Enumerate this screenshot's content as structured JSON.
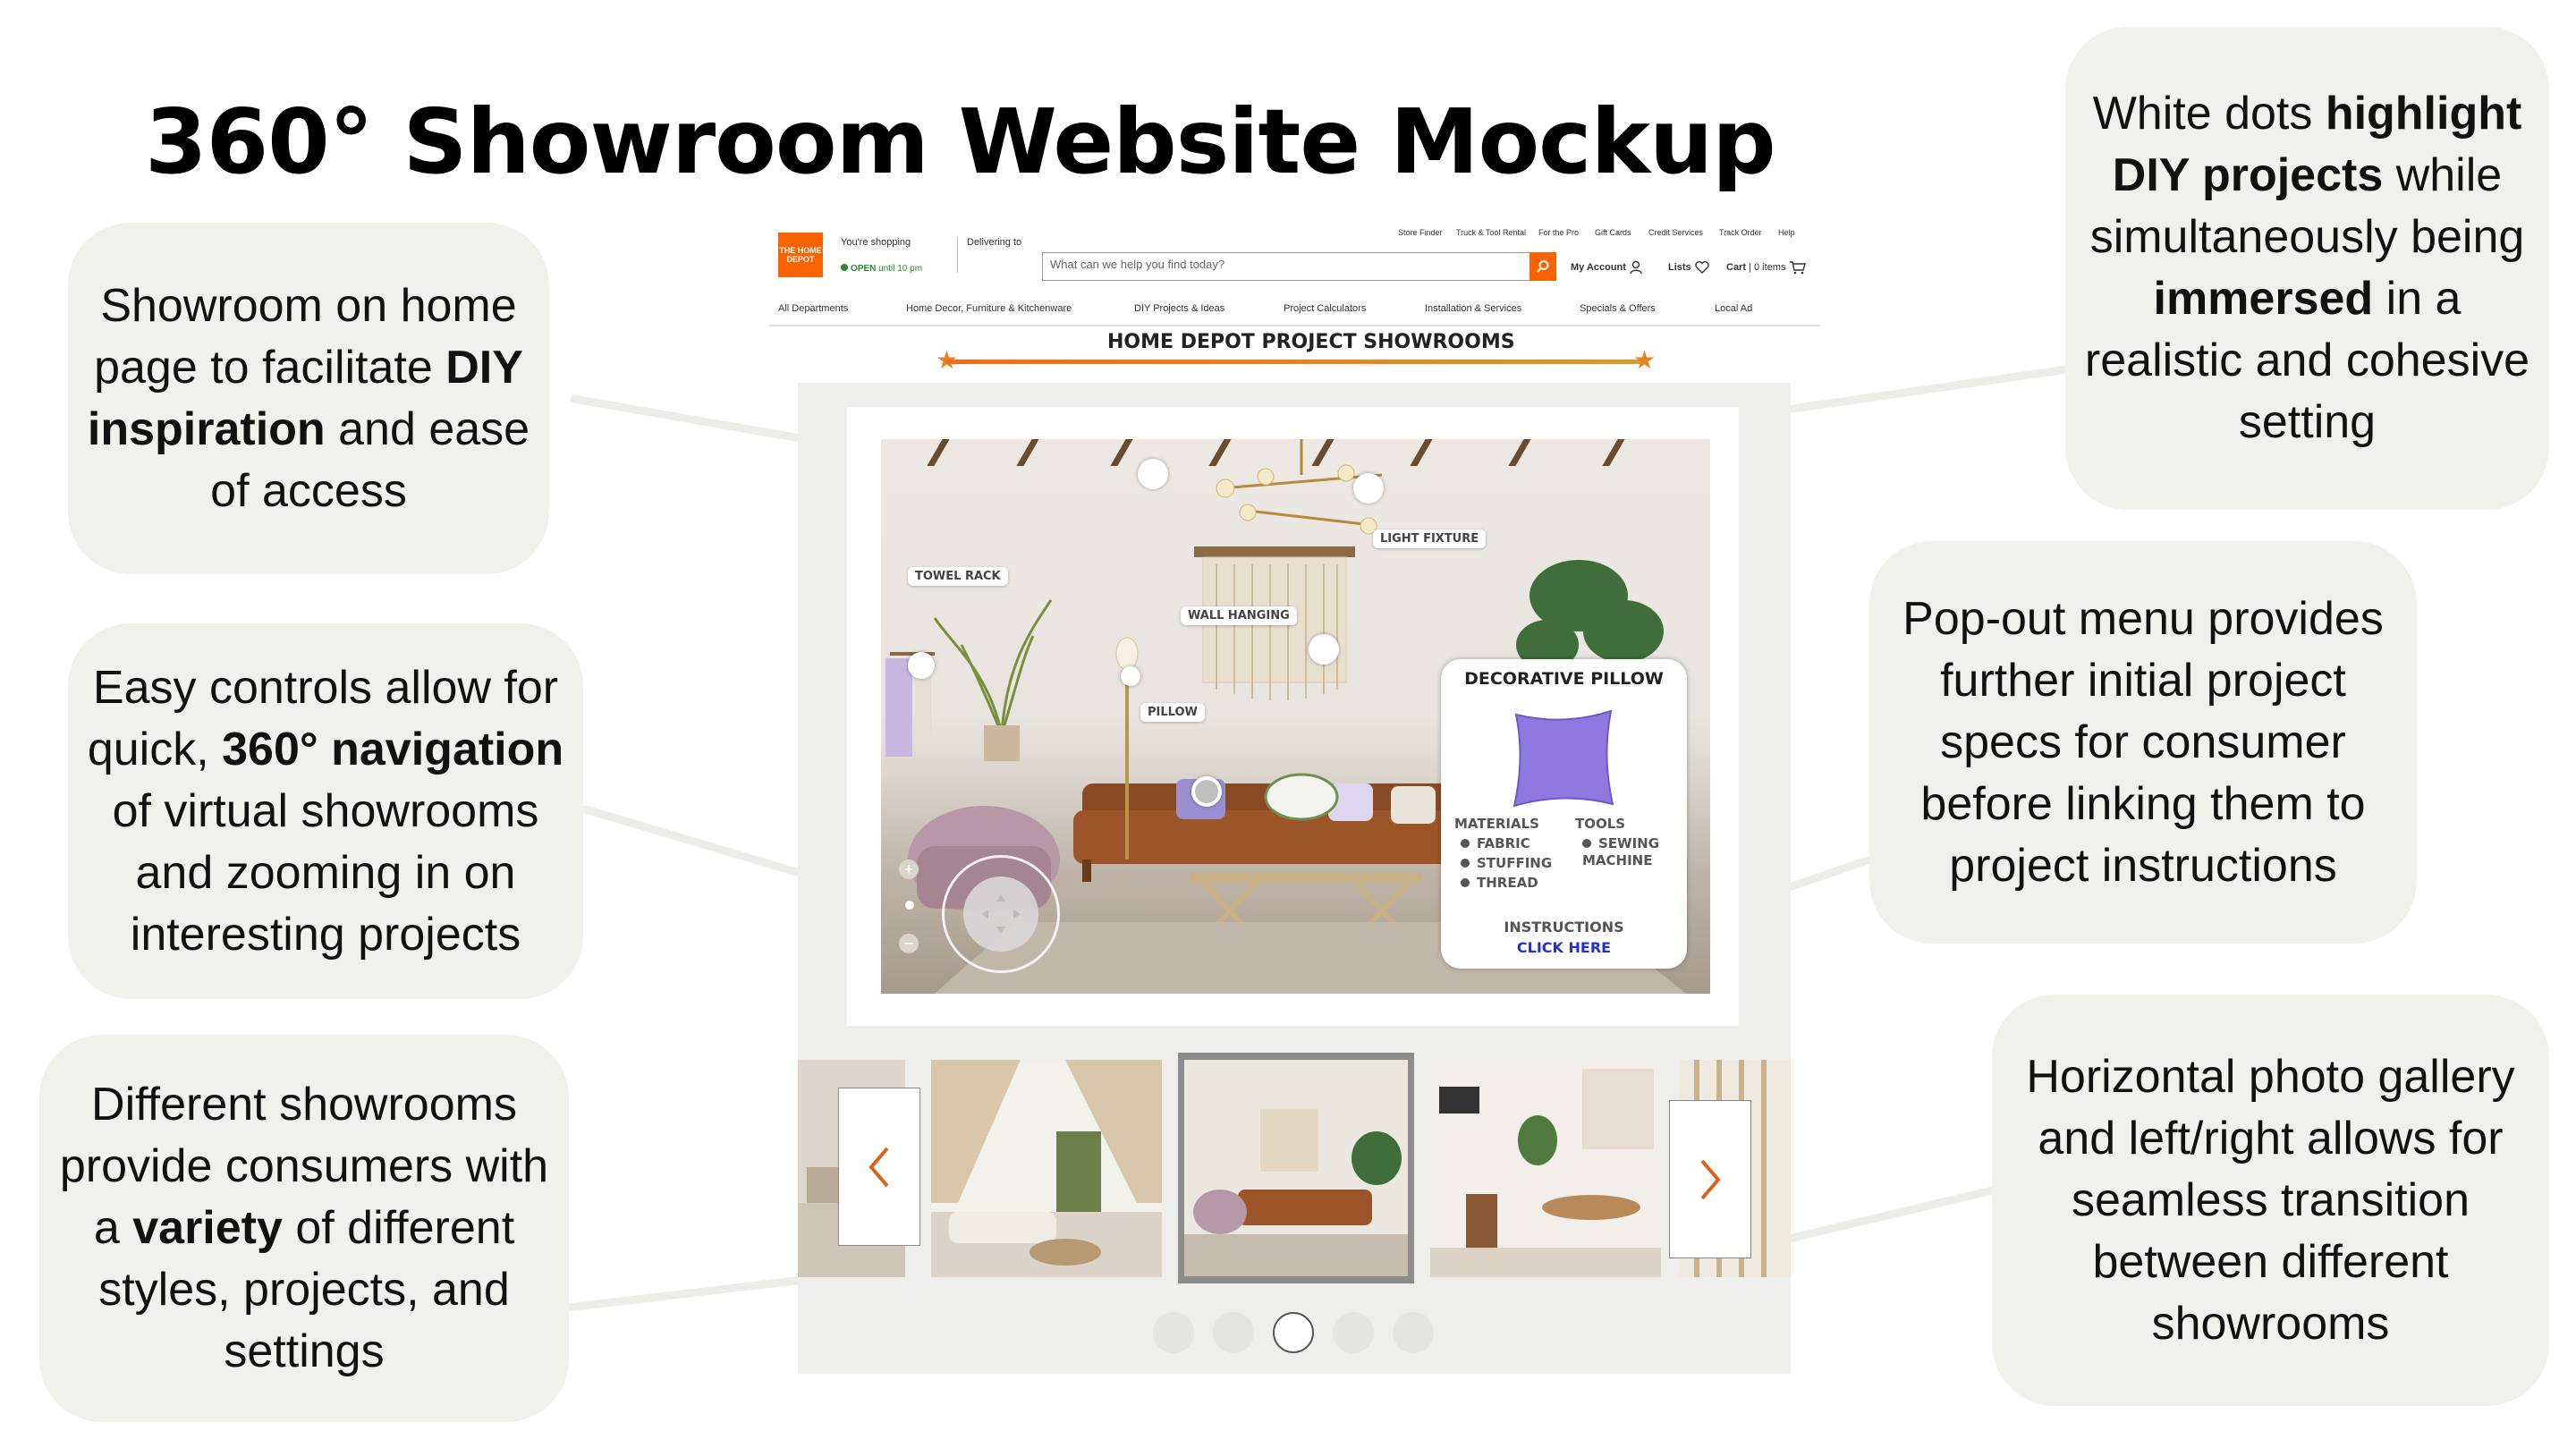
{
  "title": "360° Showroom Website Mockup",
  "callouts": {
    "left_1": {
      "pre": "Showroom on home page to facilitate ",
      "bold": "DIY inspiration",
      "post": " and ease of access"
    },
    "left_2": {
      "pre": "Easy controls allow for quick, ",
      "bold": "360° navigation",
      "post": " of virtual showrooms and zooming in on interesting projects"
    },
    "left_3": {
      "pre": "Different showrooms provide consumers with a ",
      "bold": "variety",
      "post": " of different styles, projects, and settings"
    },
    "right_1": {
      "p1": "White dots ",
      "b1": "highlight DIY projects",
      "p2": " while simultaneously being ",
      "b2": "immersed",
      "p3": " in a realistic and cohesive setting"
    },
    "right_2": "Pop-out menu provides further initial project specs for consumer before linking them to project instructions",
    "right_3": "Horizontal photo gallery and left/right allows for seamless transition between different showrooms"
  },
  "site": {
    "logo": "THE HOME DEPOT",
    "youre_shopping": "You're shopping",
    "open_status": "OPEN",
    "open_hours": "until 10 pm",
    "delivering_to": "Delivering to",
    "utility_links": [
      "Store Finder",
      "Truck & Tool Rental",
      "For the Pro",
      "Gift Cards",
      "Credit Services",
      "Track Order",
      "Help"
    ],
    "search_placeholder": "What can we help you find today?",
    "my_account": "My Account",
    "lists": "Lists",
    "cart": "Cart",
    "cart_items": "0 items",
    "nav": [
      "All Departments",
      "Home Decor, Furniture & Kitchenware",
      "DIY Projects & Ideas",
      "Project Calculators",
      "Installation & Services",
      "Specials & Offers",
      "Local Ad"
    ]
  },
  "showroom": {
    "heading": "HOME DEPOT PROJECT SHOWROOMS",
    "tags": {
      "light_fixture": "LIGHT FIXTURE",
      "towel_rack": "TOWEL RACK",
      "wall_hanging": "WALL HANGING",
      "pillow": "PILLOW"
    },
    "popout": {
      "title": "DECORATIVE PILLOW",
      "materials_heading": "MATERIALS",
      "materials": [
        "FABRIC",
        "STUFFING",
        "THREAD"
      ],
      "tools_heading": "TOOLS",
      "tools": [
        "SEWING MACHINE"
      ],
      "instructions": "INSTRUCTIONS",
      "link": "CLICK HERE"
    },
    "zoom_in": "+",
    "zoom_out": "−",
    "pager_count": 5,
    "pager_active": 3
  },
  "colors": {
    "brand_orange": "#f96302",
    "bubble_bg": "#f0f0ed",
    "link_blue": "#2233cc"
  }
}
